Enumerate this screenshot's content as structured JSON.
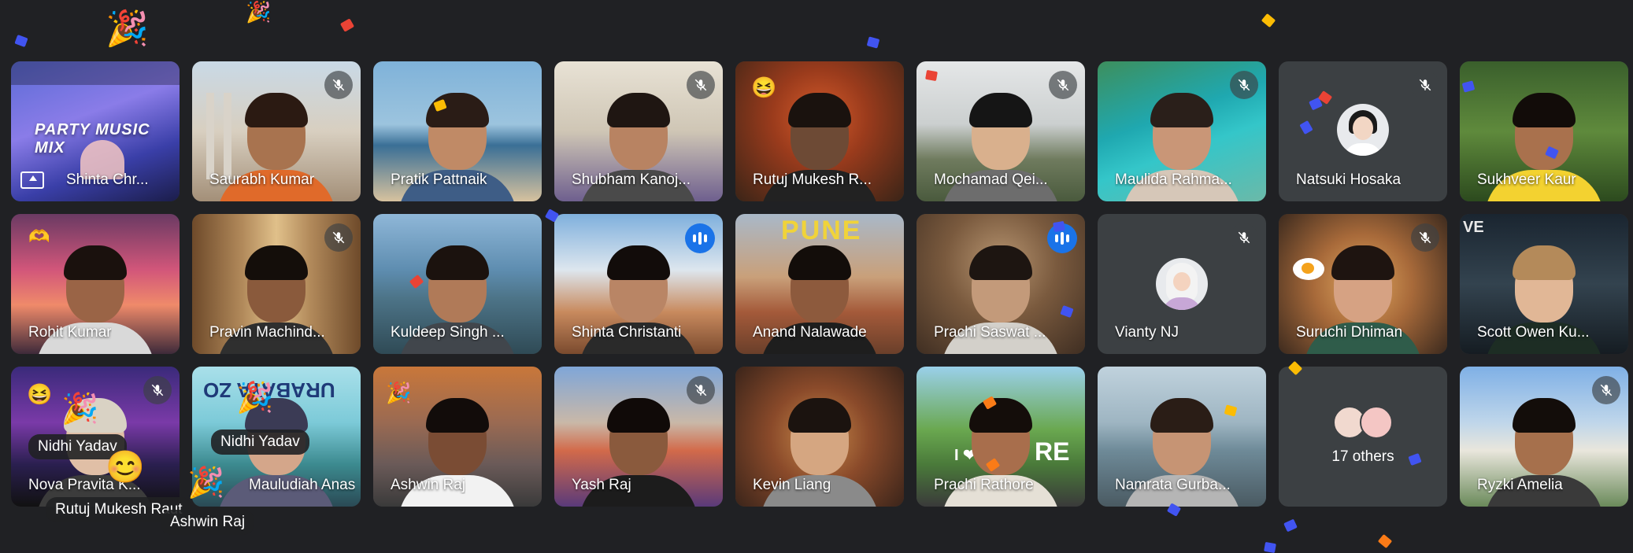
{
  "meeting": {
    "presentation": {
      "slide_title": "PARTY MUSIC MIX",
      "presenter_name": "Shinta Chr..."
    },
    "participants": [
      {
        "name": "Saurabh Kumar",
        "muted": true
      },
      {
        "name": "Pratik Pattnaik",
        "muted": false
      },
      {
        "name": "Shubham Kanoj...",
        "muted": true
      },
      {
        "name": "Rutuj Mukesh R...",
        "muted": false
      },
      {
        "name": "Mochamad Qei...",
        "muted": true
      },
      {
        "name": "Maulida Rahma...",
        "muted": true
      },
      {
        "name": "Natsuki Hosaka",
        "muted": true
      },
      {
        "name": "Sukhveer Kaur",
        "muted": false
      },
      {
        "name": "Rohit Kumar",
        "muted": false
      },
      {
        "name": "Pravin Machind...",
        "muted": true
      },
      {
        "name": "Kuldeep Singh ...",
        "muted": false
      },
      {
        "name": "Shinta Christanti",
        "speaking": true
      },
      {
        "name": "Anand Nalawade",
        "muted": false
      },
      {
        "name": "Prachi Saswat ...",
        "speaking": true
      },
      {
        "name": "Vianty NJ",
        "muted": true
      },
      {
        "name": "Suruchi Dhiman",
        "muted": true
      },
      {
        "name": "Scott Owen Ku...",
        "muted": false
      },
      {
        "name": "Nova Pravita K...",
        "muted": true
      },
      {
        "name": "Mauludiah Anas",
        "muted": false
      },
      {
        "name": "Ashwin Raj",
        "muted": false
      },
      {
        "name": "Yash Raj",
        "muted": true
      },
      {
        "name": "Kevin Liang",
        "muted": false
      },
      {
        "name": "Prachi Rathore",
        "muted": false
      },
      {
        "name": "Namrata Gurba...",
        "muted": false
      },
      {
        "name": "Ryzki Amelia",
        "muted": true
      }
    ],
    "others_count": "17 others",
    "background_texts": {
      "pune": "PUNE",
      "surabaya": "URABAYA ZO",
      "sign_letters": "RE",
      "sign_heart": "I ❤",
      "live": "VE"
    },
    "floating_reaction_names": [
      "Nidhi Yadav",
      "Nidhi Yadav",
      "Rutuj Mukesh Raut",
      "Ashwin Raj"
    ],
    "emoji": {
      "party": "🎉",
      "laugh": "😆",
      "smile": "😊",
      "heart_hands": "🫶"
    },
    "colors": {
      "background": "#202124",
      "tile": "#3c4043",
      "speaking_blue": "#1a73e8",
      "confetti_blue": "#4154f1",
      "confetti_red": "#ea4335",
      "confetti_yellow": "#fbbc04",
      "confetti_orange": "#fa7b17"
    }
  }
}
